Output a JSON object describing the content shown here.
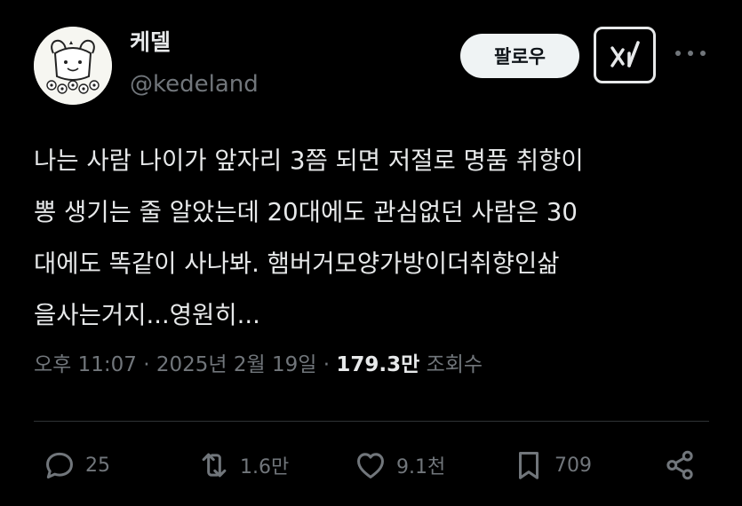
{
  "author": {
    "name": "케델",
    "handle": "@kedeland"
  },
  "follow_label": "팔로우",
  "tweet_lines": [
    "나는 사람 나이가 앞자리 3쯤 되면 저절로 명품 취향이",
    "뽕 생기는 줄 알았는데 20대에도 관심없던 사람은 30",
    "대에도 똑같이 사나봐. 햄버거모양가방이더취향인삶",
    "을사는거지...영원히..."
  ],
  "meta": {
    "time": "오후 11:07",
    "separator": "·",
    "date": "2025년 2월 19일",
    "views": "179.3만",
    "views_label": "조회수"
  },
  "actions": {
    "replies": "25",
    "reposts": "1.6만",
    "likes": "9.1천",
    "bookmarks": "709"
  },
  "icons": [
    "avatar",
    "grok-icon",
    "more-icon",
    "reply-icon",
    "repost-icon",
    "like-icon",
    "bookmark-icon",
    "share-icon"
  ],
  "colors": {
    "background": "#000000",
    "text": "#e7e9ea",
    "muted": "#71767b",
    "follow_bg": "#eff3f4"
  }
}
